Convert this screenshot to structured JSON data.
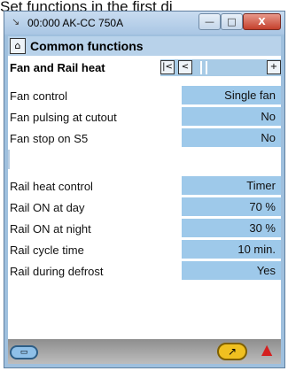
{
  "caption_text": "Set functions in the first di",
  "window": {
    "title": "00:000 AK-CC 750A",
    "title_icon": "↘",
    "min_label": "—",
    "max_label": "□",
    "close_label": "X"
  },
  "header": {
    "title": "Common functions",
    "home_icon": "⌂"
  },
  "subheader": {
    "title": "Fan and Rail heat",
    "nav_first": "|<",
    "nav_prev": "<",
    "nav_next": "+"
  },
  "rows": [
    {
      "label": "Fan control",
      "value": "Single fan"
    },
    {
      "label": "Fan pulsing at cutout",
      "value": "No"
    },
    {
      "label": "Fan stop on S5",
      "value": "No"
    },
    {
      "label": "",
      "value": ""
    },
    {
      "label": "Rail heat control",
      "value": "Timer"
    },
    {
      "label": "Rail ON at day",
      "value": "70 %"
    },
    {
      "label": "Rail ON at night",
      "value": "30 %"
    },
    {
      "label": "Rail cycle time",
      "value": "10 min."
    },
    {
      "label": "Rail during defrost",
      "value": "Yes"
    }
  ],
  "bottom": {
    "left_icon": "▭",
    "clock_icon": "↗",
    "alarm_icon": "▲"
  }
}
